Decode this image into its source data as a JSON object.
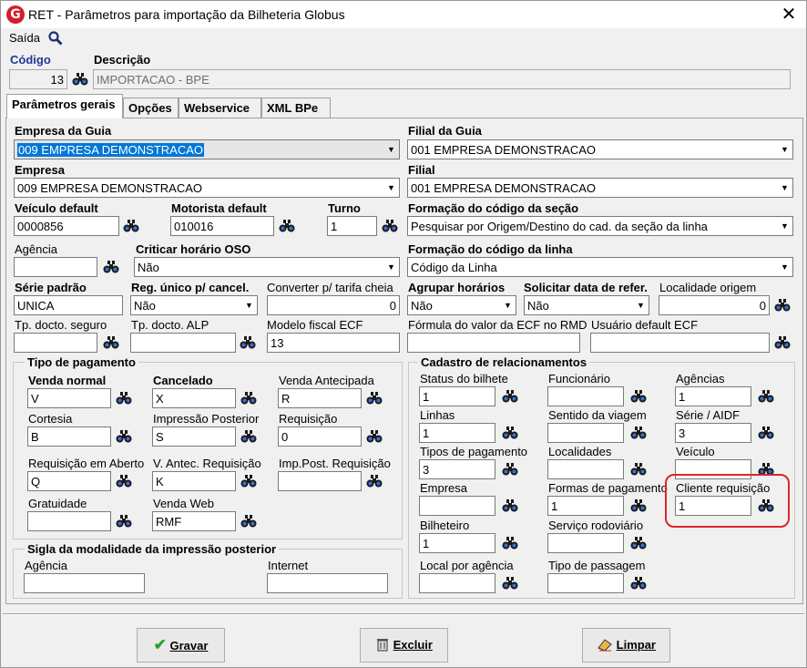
{
  "window": {
    "title": "RET - Parâmetros para importação da Bilheteria Globus",
    "logo": "G",
    "close": "✕"
  },
  "menu": {
    "saida": "Saída"
  },
  "header": {
    "codigo_label": "Código",
    "codigo_value": "13",
    "descricao_label": "Descrição",
    "descricao_value": "IMPORTACAO - BPE"
  },
  "tabs": [
    "Parâmetros gerais",
    "Opções",
    "Webservice",
    "XML BPe"
  ],
  "form": {
    "empresa_guia_label": "Empresa da Guia",
    "empresa_guia_value": "009 EMPRESA DEMONSTRACAO",
    "filial_guia_label": "Filial da Guia",
    "filial_guia_value": "001 EMPRESA DEMONSTRACAO",
    "empresa_label": "Empresa",
    "empresa_value": "009 EMPRESA DEMONSTRACAO",
    "filial_label": "Filial",
    "filial_value": "001 EMPRESA DEMONSTRACAO",
    "veiculo_label": "Veículo default",
    "veiculo_value": "0000856",
    "motorista_label": "Motorista default",
    "motorista_value": "010016",
    "turno_label": "Turno",
    "turno_value": "1",
    "formacao_secao_label": "Formação do código da seção",
    "formacao_secao_value": "Pesquisar por Origem/Destino do cad. da seção da linha",
    "agencia_label": "Agência",
    "agencia_value": "",
    "criticar_label": "Criticar horário OSO",
    "criticar_value": "Não",
    "formacao_linha_label": "Formação do código da linha",
    "formacao_linha_value": "Código da Linha",
    "serie_label": "Série  padrão",
    "serie_value": "UNICA",
    "reg_unico_label": "Reg. único p/ cancel.",
    "reg_unico_value": "Não",
    "converter_label": "Converter p/ tarifa cheia",
    "converter_value": "0",
    "agrupar_label": "Agrupar horários",
    "agrupar_value": "Não",
    "solicitar_label": "Solicitar data de refer.",
    "solicitar_value": "Não",
    "localidade_origem_label": "Localidade origem",
    "localidade_origem_value": "0",
    "tp_seguro_label": "Tp. docto. seguro",
    "tp_seguro_value": "",
    "tp_alp_label": "Tp. docto. ALP",
    "tp_alp_value": "",
    "modelo_fiscal_label": "Modelo fiscal ECF",
    "modelo_fiscal_value": "13",
    "formula_label": "Fórmula do valor da ECF no RMD",
    "formula_value": "",
    "usuario_default_label": "Usuário default ECF",
    "usuario_default_value": ""
  },
  "pagamento": {
    "title": "Tipo de pagamento",
    "venda_normal_label": "Venda normal",
    "venda_normal_value": "V",
    "cancelado_label": "Cancelado",
    "cancelado_value": "X",
    "venda_antecipada_label": "Venda Antecipada",
    "venda_antecipada_value": "R",
    "cortesia_label": "Cortesia",
    "cortesia_value": "B",
    "impressao_posterior_label": "Impressão Posterior",
    "impressao_posterior_value": "S",
    "requisicao_label": "Requisição",
    "requisicao_value": "0",
    "requisicao_aberto_label": "Requisição em Aberto",
    "requisicao_aberto_value": "Q",
    "v_antec_label": "V. Antec. Requisição",
    "v_antec_value": "K",
    "imp_post_label": "Imp.Post. Requisição",
    "imp_post_value": "",
    "gratuidade_label": "Gratuidade",
    "gratuidade_value": "",
    "venda_web_label": "Venda Web",
    "venda_web_value": "RMF"
  },
  "sigla": {
    "title": "Sigla da modalidade da impressão posterior",
    "agencia_label": "Agência",
    "agencia_value": "",
    "internet_label": "Internet",
    "internet_value": ""
  },
  "cadastro": {
    "title": "Cadastro de relacionamentos",
    "status_label": "Status do bilhete",
    "status_value": "1",
    "funcionario_label": "Funcionário",
    "funcionario_value": "",
    "agencias_label": "Agências",
    "agencias_value": "1",
    "linhas_label": "Linhas",
    "linhas_value": "1",
    "sentido_label": "Sentido da viagem",
    "sentido_value": "",
    "serie_aidf_label": "Série / AIDF",
    "serie_aidf_value": "3",
    "tipos_pag_label": "Tipos de pagamento",
    "tipos_pag_value": "3",
    "localidades_label": "Localidades",
    "localidades_value": "",
    "veiculo_label": "Veículo",
    "veiculo_value": "",
    "empresa_label": "Empresa",
    "empresa_value": "",
    "formas_pag_label": "Formas de pagamento",
    "formas_pag_value": "1",
    "cliente_req_label": "Cliente requisição",
    "cliente_req_value": "1",
    "bilheteiro_label": "Bilheteiro",
    "bilheteiro_value": "1",
    "servico_label": "Serviço rodoviário",
    "servico_value": "",
    "local_agencia_label": "Local por agência",
    "local_agencia_value": "",
    "tipo_passagem_label": "Tipo de passagem",
    "tipo_passagem_value": ""
  },
  "buttons": {
    "gravar": "Gravar",
    "excluir": "Excluir",
    "limpar": "Limpar"
  },
  "icons": {
    "arrow": "▼",
    "check": "✔"
  },
  "colors": {
    "highlight": "#0078d7",
    "annotation": "#d9262b",
    "logo": "#d21f2b"
  }
}
